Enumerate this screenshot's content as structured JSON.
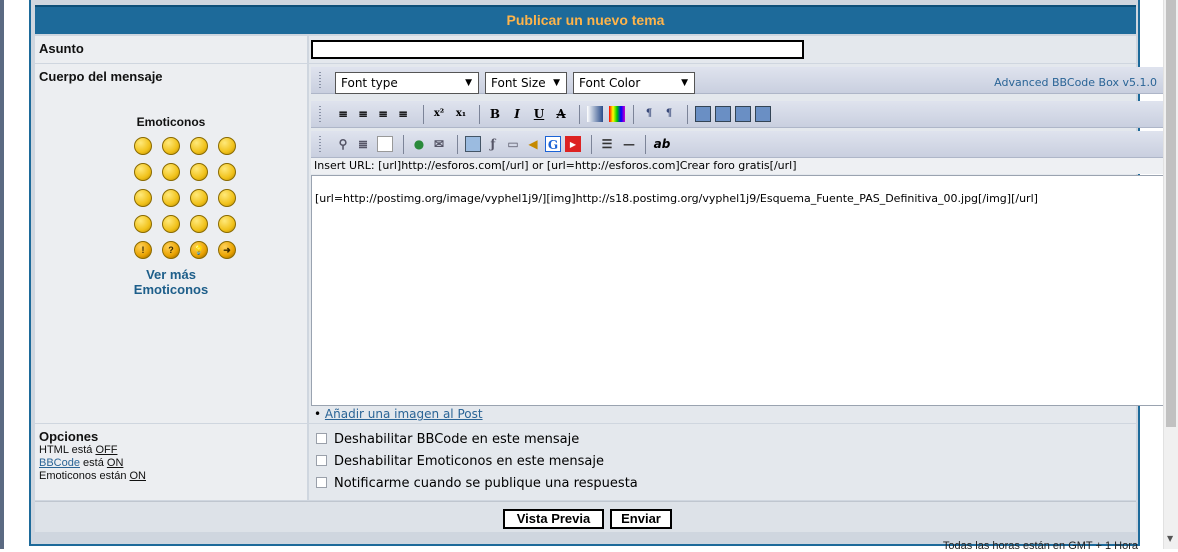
{
  "form": {
    "title": "Publicar un nuevo tema",
    "subject_label": "Asunto",
    "subject_value": "",
    "body_label": "Cuerpo del mensaje"
  },
  "emoticons": {
    "title": "Emoticonos",
    "more_line1": "Ver más",
    "more_line2": "Emoticonos",
    "faces": [
      "😄",
      "😃",
      "🙁",
      "😲",
      "😎",
      "😕",
      "😎",
      "😜",
      "😠",
      "😀",
      "😳",
      "😟",
      "😈",
      "😈",
      "😵",
      "🙂",
      "!",
      "?",
      "💡",
      "➜"
    ]
  },
  "toolbar": {
    "font_type": "Font type",
    "font_size": "Font Size",
    "font_color": "Font Color",
    "version": "Advanced BBCode Box v5.1.0",
    "icons": {
      "align_left": "≡",
      "align_center": "≡",
      "align_right": "≡",
      "justify": "≡",
      "superscript": "x²",
      "subscript": "x₁",
      "bold": "B",
      "italic": "I",
      "underline": "U",
      "strike": "A",
      "gradient": "▐",
      "rainbow": "▐",
      "ltr": "¶",
      "rtl": "¶",
      "horizontal_rule": "—",
      "spell": "ab"
    }
  },
  "editor": {
    "insert_url_hint": "Insert URL: [url]http://esforos.com[/url] or [url=http://esforos.com]Crear foro gratis[/url]",
    "message": "[url=http://postimg.org/image/vyphel1j9/][img]http://s18.postimg.org/vyphel1j9/Esquema_Fuente_PAS_Definitiva_00.jpg[/img][/url]",
    "add_image_bullet": "•",
    "add_image_link": "Añadir una imagen al Post"
  },
  "options": {
    "title": "Opciones",
    "html_prefix": "HTML está ",
    "html_state": "OFF",
    "bbcode_link": "BBCode",
    "bbcode_mid": " está ",
    "bbcode_state": "ON",
    "emo_prefix": "Emoticonos están ",
    "emo_state": "ON",
    "items": [
      "Deshabilitar BBCode en este mensaje",
      "Deshabilitar Emoticonos en este mensaje",
      "Notificarme cuando se publique una respuesta"
    ]
  },
  "buttons": {
    "preview": "Vista Previa",
    "submit": "Enviar"
  },
  "footer": {
    "timezone": "Todas las horas están en GMT + 1 Hora"
  }
}
